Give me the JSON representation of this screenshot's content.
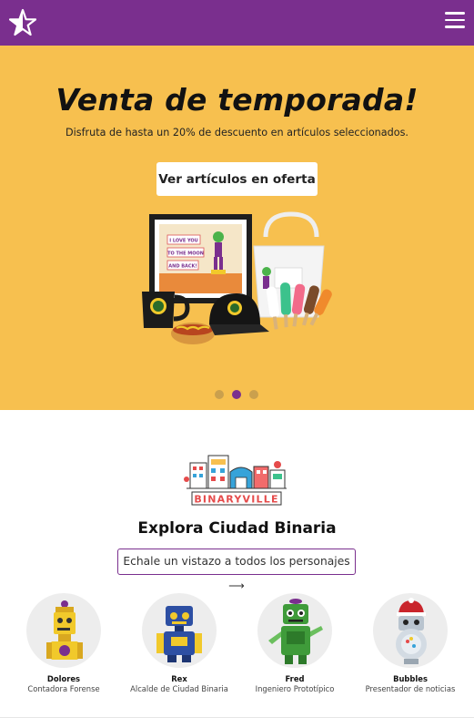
{
  "header": {
    "logo_icon": "star-outline-icon",
    "menu_icon": "hamburger-menu-icon",
    "brand_color": "#7a2f8e"
  },
  "hero": {
    "title": "Venta de temporada!",
    "subtitle": "Disfruta de hasta un 20% de descuento en artículos seleccionados.",
    "cta_label": "Ver artículos en oferta",
    "background_color": "#f7c04f",
    "product_image_text": [
      "I LOVE YOU",
      "TO THE MOON",
      "AND BACK!"
    ],
    "carousel": {
      "slides": 3,
      "active": 2
    }
  },
  "explore": {
    "logo_text": "BINARYVILLE",
    "title": "Explora Ciudad Binaria",
    "link_label": "Echale un vistazo a todos los personajes ⟶"
  },
  "characters": [
    {
      "name": "Dolores",
      "role": "Contadora Forense",
      "color": "#f1c92b"
    },
    {
      "name": "Rex",
      "role": "Alcalde de Ciudad Binaria",
      "color": "#2d4fa3"
    },
    {
      "name": "Fred",
      "role": "Ingeniero Prototípico",
      "color": "#3f9b3a"
    },
    {
      "name": "Bubbles",
      "role": "Presentador de noticias",
      "color": "#b9c4cf"
    }
  ]
}
